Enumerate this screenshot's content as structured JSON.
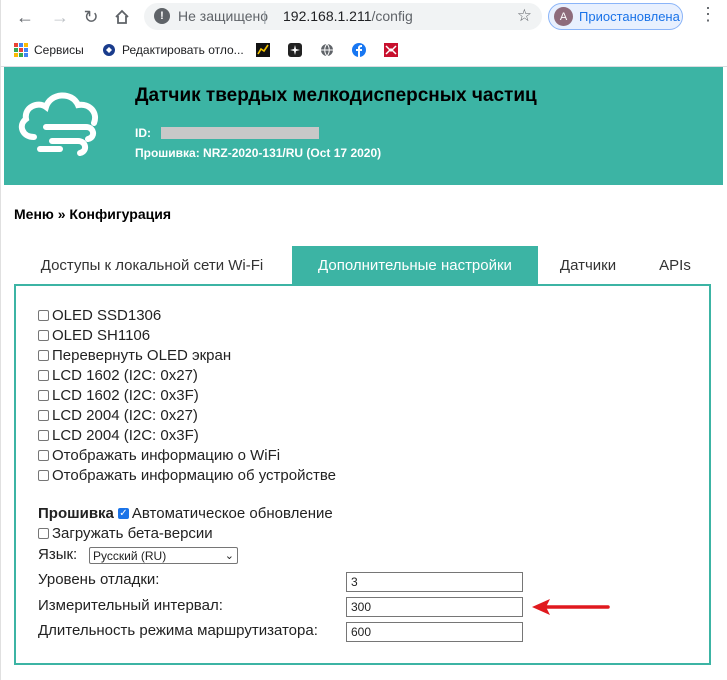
{
  "browser": {
    "security_label": "Не защищено",
    "separator": "|",
    "url_host": "192.168.1.211",
    "url_path": "/config",
    "profile_initial": "А",
    "profile_status": "Приостановлена",
    "bookmarks": [
      {
        "label": "Сервисы"
      },
      {
        "label": "Редактировать отло..."
      }
    ]
  },
  "header": {
    "title": "Датчик твердых мелкодисперсных частиц",
    "id_label": "ID:",
    "firmware_line": "Прошивка: NRZ-2020-131/RU (Oct 17 2020)",
    "color": "#3cb4a4"
  },
  "breadcrumb": "Меню » Конфигурация",
  "tabs": [
    {
      "label": "Доступы к локальной сети Wi-Fi",
      "active": false
    },
    {
      "label": "Дополнительные настройки",
      "active": true
    },
    {
      "label": "Датчики",
      "active": false
    },
    {
      "label": "APIs",
      "active": false
    }
  ],
  "display_options": [
    {
      "label": "OLED SSD1306",
      "checked": false
    },
    {
      "label": "OLED SH1106",
      "checked": false
    },
    {
      "label": "Перевернуть OLED экран",
      "checked": false
    },
    {
      "label": "LCD 1602 (I2C: 0x27)",
      "checked": false
    },
    {
      "label": "LCD 1602 (I2C: 0x3F)",
      "checked": false
    },
    {
      "label": "LCD 2004 (I2C: 0x27)",
      "checked": false
    },
    {
      "label": "LCD 2004 (I2C: 0x3F)",
      "checked": false
    },
    {
      "label": "Отображать информацию о WiFi",
      "checked": false
    },
    {
      "label": "Отображать информацию об устройстве",
      "checked": false
    }
  ],
  "firmware": {
    "section_label": "Прошивка",
    "auto_update_label": "Автоматическое обновление",
    "auto_update_checked": true,
    "beta_label": "Загружать бета-версии",
    "beta_checked": false,
    "language_label": "Язык:",
    "language_value": "Русский (RU)"
  },
  "fields": [
    {
      "label": "Уровень отладки:",
      "value": "3"
    },
    {
      "label": "Измерительный интервал:",
      "value": "300"
    },
    {
      "label": "Длительность режима маршрутизатора:",
      "value": "600"
    }
  ],
  "annotation_color": "#e0191e"
}
